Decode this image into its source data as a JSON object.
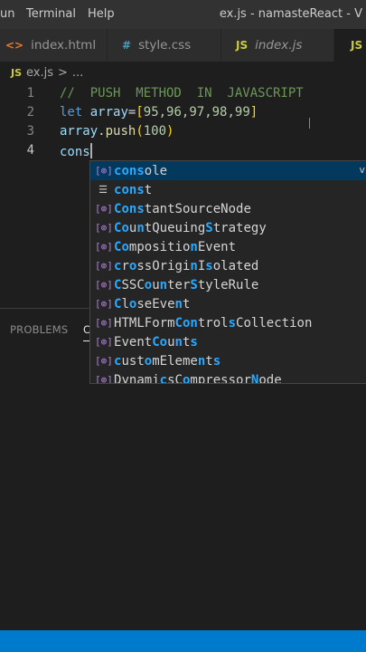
{
  "titlebar": {
    "menus": [
      "un",
      "Terminal",
      "Help"
    ],
    "window_title": "ex.js - namasteReact - V"
  },
  "tabs": [
    {
      "label": "index.html",
      "icon": "html-icon",
      "icon_text": "<>",
      "icon_color": "#e37933"
    },
    {
      "label": "style.css",
      "icon": "css-icon",
      "icon_text": "#",
      "icon_color": "#519aba"
    },
    {
      "label": "index.js",
      "icon": "js-icon",
      "icon_text": "JS",
      "icon_color": "#cbcb41"
    },
    {
      "label": "",
      "icon": "js-icon",
      "icon_text": "JS",
      "icon_color": "#cbcb41"
    }
  ],
  "breadcrumb": {
    "icon_text": "JS",
    "file": "ex.js",
    "separator": ">",
    "more": "..."
  },
  "editor": {
    "line_numbers": [
      "1",
      "2",
      "3",
      "4"
    ],
    "line1": {
      "comment": "//  PUSH  METHOD  IN  JAVASCRIPT"
    },
    "line2": {
      "kw": "let",
      "name": "array",
      "eq": "=",
      "open": "[",
      "values": "95,96,97,98,99",
      "close": "]"
    },
    "line3": {
      "obj": "array",
      "dot": ".",
      "method": "push",
      "open": "(",
      "arg": "100",
      "close": ")"
    },
    "line4": {
      "typed": "cons"
    }
  },
  "suggest": {
    "detail": "v",
    "items": [
      {
        "kind": "[⊚]",
        "label": "console"
      },
      {
        "kind": "☰",
        "label": "const"
      },
      {
        "kind": "[⊚]",
        "label": "ConstantSourceNode"
      },
      {
        "kind": "[⊚]",
        "label": "CountQueuingStrategy"
      },
      {
        "kind": "[⊚]",
        "label": "CompositionEvent"
      },
      {
        "kind": "[⊚]",
        "label": "crossOriginIsolated"
      },
      {
        "kind": "[⊚]",
        "label": "CSSCounterStyleRule"
      },
      {
        "kind": "[⊚]",
        "label": "CloseEvent"
      },
      {
        "kind": "[⊚]",
        "label": "HTMLFormControlsCollection"
      },
      {
        "kind": "[⊚]",
        "label": "EventCounts"
      },
      {
        "kind": "[⊚]",
        "label": "customElements"
      },
      {
        "kind": "[⊚]",
        "label": "DynamicsCompressorNode"
      }
    ]
  },
  "panel": {
    "tabs": [
      "PROBLEMS",
      "C"
    ]
  },
  "colors": {
    "statusbar": "#007acc",
    "selection": "#04395e",
    "match": "#2aaaff"
  }
}
